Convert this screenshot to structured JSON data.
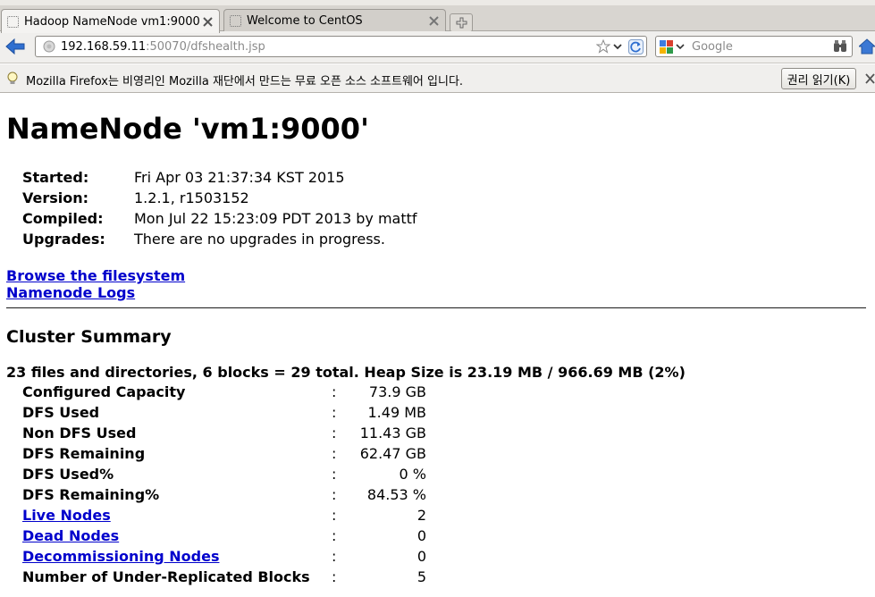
{
  "browser": {
    "tabs": [
      {
        "title": "Hadoop NameNode vm1:9000",
        "active": true
      },
      {
        "title": "Welcome to CentOS",
        "active": false
      }
    ],
    "url_host": "192.168.59.11",
    "url_path": ":50070/dfshealth.jsp",
    "search_placeholder": "Google",
    "notification": {
      "text": "Mozilla Firefox는 비영리인 Mozilla 재단에서 만드는 무료 오픈 소스 소프트웨어 입니다.",
      "button": "권리 읽기(K)"
    }
  },
  "page": {
    "title": "NameNode 'vm1:9000'",
    "info": [
      {
        "label": "Started:",
        "value": "Fri Apr 03 21:37:34 KST 2015"
      },
      {
        "label": "Version:",
        "value": "1.2.1, r1503152"
      },
      {
        "label": "Compiled:",
        "value": "Mon Jul 22 15:23:09 PDT 2013 by mattf"
      },
      {
        "label": "Upgrades:",
        "value": "There are no upgrades in progress."
      }
    ],
    "links": {
      "browse": "Browse the filesystem",
      "logs": "Namenode Logs"
    },
    "cluster_summary": {
      "heading": "Cluster Summary",
      "summary_line": "23 files and directories, 6 blocks = 29 total. Heap Size is 23.19 MB / 966.69 MB (2%)",
      "separator": ":",
      "rows": [
        {
          "label": "Configured Capacity",
          "value": "73.9 GB"
        },
        {
          "label": "DFS Used",
          "value": "1.49 MB"
        },
        {
          "label": "Non DFS Used",
          "value": "11.43 GB"
        },
        {
          "label": "DFS Remaining",
          "value": "62.47 GB"
        },
        {
          "label": "DFS Used%",
          "value": "0 %"
        },
        {
          "label": "DFS Remaining%",
          "value": "84.53 %"
        },
        {
          "label": "Live Nodes",
          "value": "2"
        },
        {
          "label": "Dead Nodes",
          "value": "0"
        },
        {
          "label": "Decommissioning Nodes",
          "value": "0"
        },
        {
          "label": "Number of Under-Replicated Blocks",
          "value": "5"
        }
      ]
    }
  },
  "colors": {
    "link": "#0000cc",
    "chrome": "#f0efed",
    "back_arrow": "#2f6fd0"
  },
  "icons": {
    "back": "back-arrow-icon",
    "site": "globe-icon",
    "bookmark": "star-icon",
    "reload": "reload-icon",
    "search_engine": "google-icon",
    "search_go": "binoculars-icon",
    "home": "home-icon",
    "info": "lightbulb-icon"
  }
}
